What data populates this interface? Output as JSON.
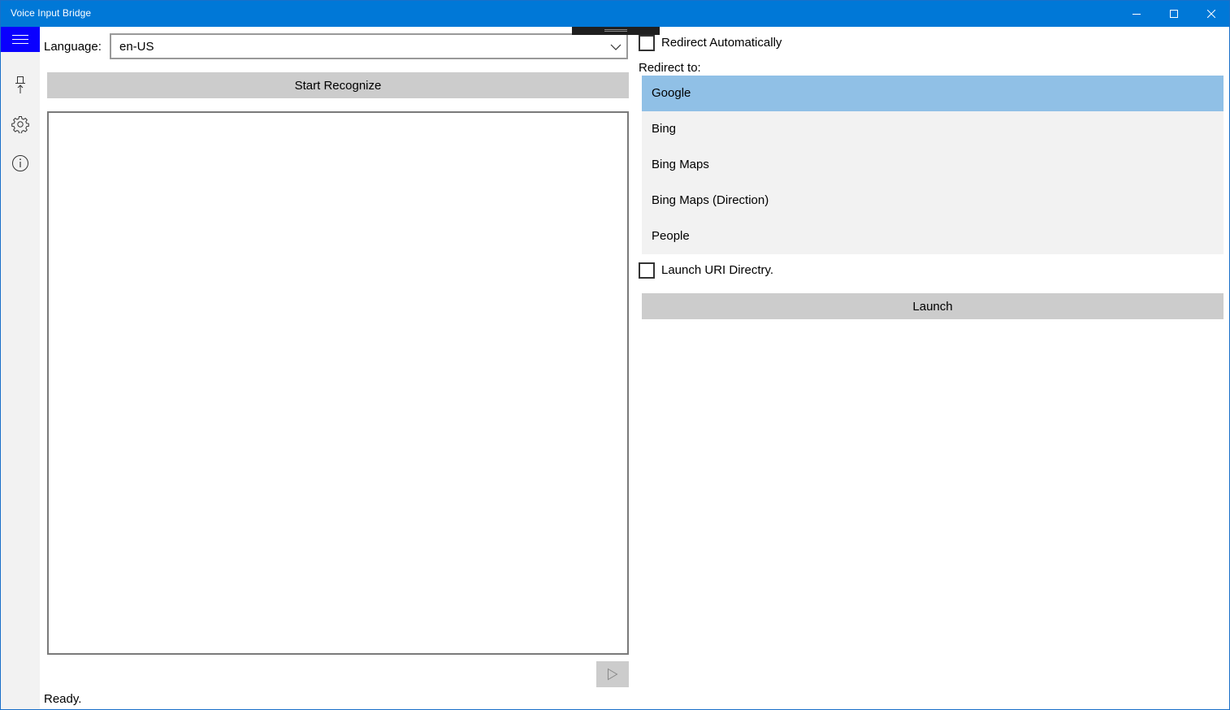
{
  "window": {
    "title": "Voice Input Bridge",
    "accent_color": "#0078d7"
  },
  "titlebar_buttons": {
    "minimize_icon": "minimize-icon",
    "maximize_icon": "maximize-icon",
    "close_icon": "close-icon"
  },
  "rail": {
    "hamburger_color": "#0a00ff",
    "items": [
      {
        "icon": "pin-icon"
      },
      {
        "icon": "gear-icon"
      },
      {
        "icon": "info-icon"
      }
    ]
  },
  "recognizer": {
    "language_label": "Language:",
    "language_value": "en-US",
    "start_button_label": "Start Recognize",
    "result_text": "",
    "play_icon": "play-icon",
    "status_text": "Ready."
  },
  "redirect": {
    "auto_label": "Redirect Automatically",
    "auto_checked": false,
    "redirect_to_label": "Redirect to:",
    "items": [
      {
        "label": "Google",
        "selected": true
      },
      {
        "label": "Bing",
        "selected": false
      },
      {
        "label": "Bing Maps",
        "selected": false
      },
      {
        "label": "Bing Maps (Direction)",
        "selected": false
      },
      {
        "label": "People",
        "selected": false
      }
    ],
    "selected_color": "#90c0e6",
    "launch_uri_label": "Launch URI Directry.",
    "launch_uri_checked": false,
    "launch_button_label": "Launch"
  }
}
